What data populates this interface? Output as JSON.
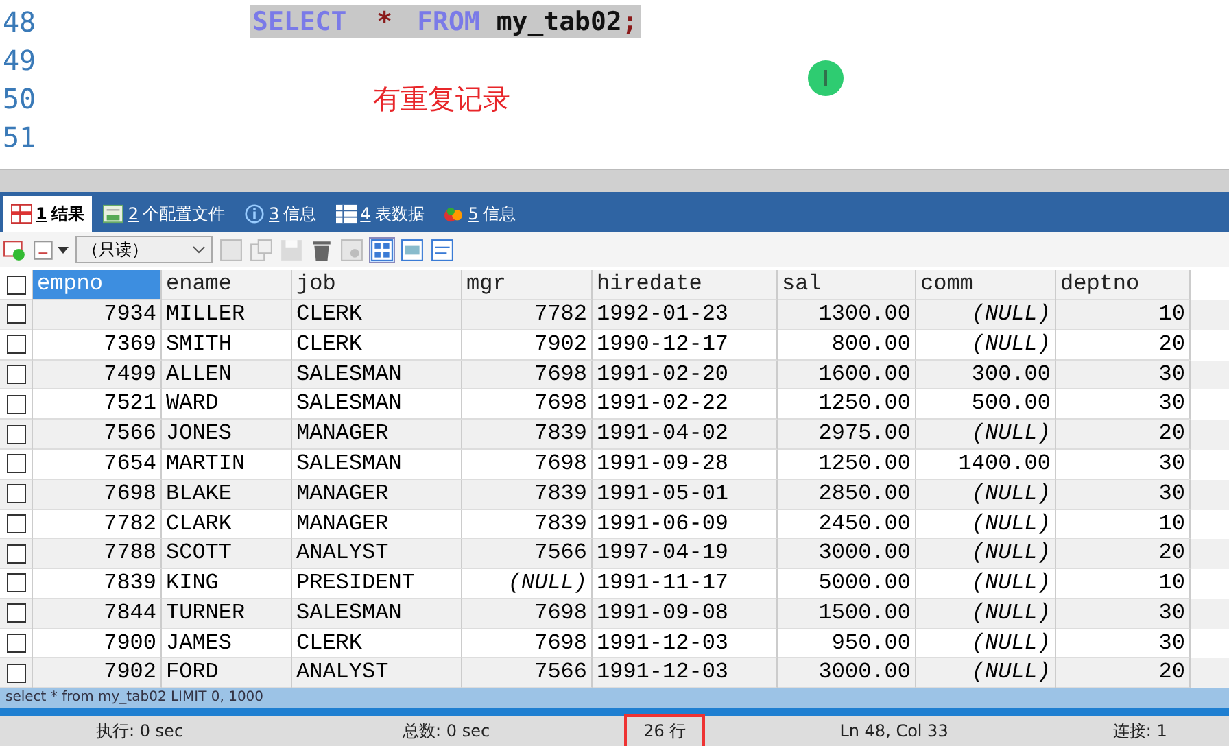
{
  "editor": {
    "lines": [
      {
        "number": "48",
        "kind": "sql",
        "keyword1": "SELECT",
        "star": "*",
        "keyword2": "FROM",
        "table": "my_tab02",
        "semicolon": ";"
      },
      {
        "number": "49",
        "kind": "blank"
      },
      {
        "number": "50",
        "kind": "note",
        "text": "有重复记录"
      },
      {
        "number": "51",
        "kind": "blank"
      }
    ]
  },
  "result_tabs": [
    {
      "number": "1",
      "label": "结果",
      "selected": true
    },
    {
      "number": "2",
      "label": "个配置文件",
      "selected": false
    },
    {
      "number": "3",
      "label": "信息",
      "selected": false
    },
    {
      "number": "4",
      "label": "表数据",
      "selected": false
    },
    {
      "number": "5",
      "label": "信息",
      "selected": false
    }
  ],
  "toolbar": {
    "mode": "（只读）"
  },
  "table": {
    "header_checked": false,
    "columns": [
      {
        "name": "empno",
        "selected": true
      },
      {
        "name": "ename",
        "selected": false
      },
      {
        "name": "job",
        "selected": false
      },
      {
        "name": "mgr",
        "selected": false
      },
      {
        "name": "hiredate",
        "selected": false
      },
      {
        "name": "sal",
        "selected": false
      },
      {
        "name": "comm",
        "selected": false
      },
      {
        "name": "deptno",
        "selected": false
      }
    ],
    "rows": [
      {
        "checked": false,
        "cells": [
          {
            "text": "7934",
            "null": false
          },
          {
            "text": "MILLER",
            "null": false
          },
          {
            "text": "CLERK",
            "null": false
          },
          {
            "text": "7782",
            "null": false
          },
          {
            "text": "1992-01-23",
            "null": false
          },
          {
            "text": "1300.00",
            "null": false
          },
          {
            "text": "(NULL)",
            "null": true
          },
          {
            "text": "10",
            "null": false
          }
        ]
      },
      {
        "checked": false,
        "cells": [
          {
            "text": "7369",
            "null": false
          },
          {
            "text": "SMITH",
            "null": false
          },
          {
            "text": "CLERK",
            "null": false
          },
          {
            "text": "7902",
            "null": false
          },
          {
            "text": "1990-12-17",
            "null": false
          },
          {
            "text": "800.00",
            "null": false
          },
          {
            "text": "(NULL)",
            "null": true
          },
          {
            "text": "20",
            "null": false
          }
        ]
      },
      {
        "checked": false,
        "cells": [
          {
            "text": "7499",
            "null": false
          },
          {
            "text": "ALLEN",
            "null": false
          },
          {
            "text": "SALESMAN",
            "null": false
          },
          {
            "text": "7698",
            "null": false
          },
          {
            "text": "1991-02-20",
            "null": false
          },
          {
            "text": "1600.00",
            "null": false
          },
          {
            "text": "300.00",
            "null": false
          },
          {
            "text": "30",
            "null": false
          }
        ]
      },
      {
        "checked": false,
        "cells": [
          {
            "text": "7521",
            "null": false
          },
          {
            "text": "WARD",
            "null": false
          },
          {
            "text": "SALESMAN",
            "null": false
          },
          {
            "text": "7698",
            "null": false
          },
          {
            "text": "1991-02-22",
            "null": false
          },
          {
            "text": "1250.00",
            "null": false
          },
          {
            "text": "500.00",
            "null": false
          },
          {
            "text": "30",
            "null": false
          }
        ]
      },
      {
        "checked": false,
        "cells": [
          {
            "text": "7566",
            "null": false
          },
          {
            "text": "JONES",
            "null": false
          },
          {
            "text": "MANAGER",
            "null": false
          },
          {
            "text": "7839",
            "null": false
          },
          {
            "text": "1991-04-02",
            "null": false
          },
          {
            "text": "2975.00",
            "null": false
          },
          {
            "text": "(NULL)",
            "null": true
          },
          {
            "text": "20",
            "null": false
          }
        ]
      },
      {
        "checked": false,
        "cells": [
          {
            "text": "7654",
            "null": false
          },
          {
            "text": "MARTIN",
            "null": false
          },
          {
            "text": "SALESMAN",
            "null": false
          },
          {
            "text": "7698",
            "null": false
          },
          {
            "text": "1991-09-28",
            "null": false
          },
          {
            "text": "1250.00",
            "null": false
          },
          {
            "text": "1400.00",
            "null": false
          },
          {
            "text": "30",
            "null": false
          }
        ]
      },
      {
        "checked": false,
        "cells": [
          {
            "text": "7698",
            "null": false
          },
          {
            "text": "BLAKE",
            "null": false
          },
          {
            "text": "MANAGER",
            "null": false
          },
          {
            "text": "7839",
            "null": false
          },
          {
            "text": "1991-05-01",
            "null": false
          },
          {
            "text": "2850.00",
            "null": false
          },
          {
            "text": "(NULL)",
            "null": true
          },
          {
            "text": "30",
            "null": false
          }
        ]
      },
      {
        "checked": false,
        "cells": [
          {
            "text": "7782",
            "null": false
          },
          {
            "text": "CLARK",
            "null": false
          },
          {
            "text": "MANAGER",
            "null": false
          },
          {
            "text": "7839",
            "null": false
          },
          {
            "text": "1991-06-09",
            "null": false
          },
          {
            "text": "2450.00",
            "null": false
          },
          {
            "text": "(NULL)",
            "null": true
          },
          {
            "text": "10",
            "null": false
          }
        ]
      },
      {
        "checked": false,
        "cells": [
          {
            "text": "7788",
            "null": false
          },
          {
            "text": "SCOTT",
            "null": false
          },
          {
            "text": "ANALYST",
            "null": false
          },
          {
            "text": "7566",
            "null": false
          },
          {
            "text": "1997-04-19",
            "null": false
          },
          {
            "text": "3000.00",
            "null": false
          },
          {
            "text": "(NULL)",
            "null": true
          },
          {
            "text": "20",
            "null": false
          }
        ]
      },
      {
        "checked": false,
        "cells": [
          {
            "text": "7839",
            "null": false
          },
          {
            "text": "KING",
            "null": false
          },
          {
            "text": "PRESIDENT",
            "null": false
          },
          {
            "text": "(NULL)",
            "null": true
          },
          {
            "text": "1991-11-17",
            "null": false
          },
          {
            "text": "5000.00",
            "null": false
          },
          {
            "text": "(NULL)",
            "null": true
          },
          {
            "text": "10",
            "null": false
          }
        ]
      },
      {
        "checked": false,
        "cells": [
          {
            "text": "7844",
            "null": false
          },
          {
            "text": "TURNER",
            "null": false
          },
          {
            "text": "SALESMAN",
            "null": false
          },
          {
            "text": "7698",
            "null": false
          },
          {
            "text": "1991-09-08",
            "null": false
          },
          {
            "text": "1500.00",
            "null": false
          },
          {
            "text": "(NULL)",
            "null": true
          },
          {
            "text": "30",
            "null": false
          }
        ]
      },
      {
        "checked": false,
        "cells": [
          {
            "text": "7900",
            "null": false
          },
          {
            "text": "JAMES",
            "null": false
          },
          {
            "text": "CLERK",
            "null": false
          },
          {
            "text": "7698",
            "null": false
          },
          {
            "text": "1991-12-03",
            "null": false
          },
          {
            "text": "950.00",
            "null": false
          },
          {
            "text": "(NULL)",
            "null": true
          },
          {
            "text": "30",
            "null": false
          }
        ]
      },
      {
        "checked": false,
        "cells": [
          {
            "text": "7902",
            "null": false
          },
          {
            "text": "FORD",
            "null": false
          },
          {
            "text": "ANALYST",
            "null": false
          },
          {
            "text": "7566",
            "null": false
          },
          {
            "text": "1991-12-03",
            "null": false
          },
          {
            "text": "3000.00",
            "null": false
          },
          {
            "text": "(NULL)",
            "null": true
          },
          {
            "text": "20",
            "null": false
          }
        ]
      }
    ]
  },
  "query_line": "select * from my_tab02 LIMIT 0, 1000",
  "status_bar": [
    {
      "text": "执行: 0 sec",
      "highlighted": false
    },
    {
      "text": "总数: 0 sec",
      "highlighted": false
    },
    {
      "text": "26 行",
      "highlighted": true
    },
    {
      "text": "Ln 48, Col 33",
      "highlighted": false
    },
    {
      "text": "连接: 1",
      "highlighted": false
    }
  ]
}
